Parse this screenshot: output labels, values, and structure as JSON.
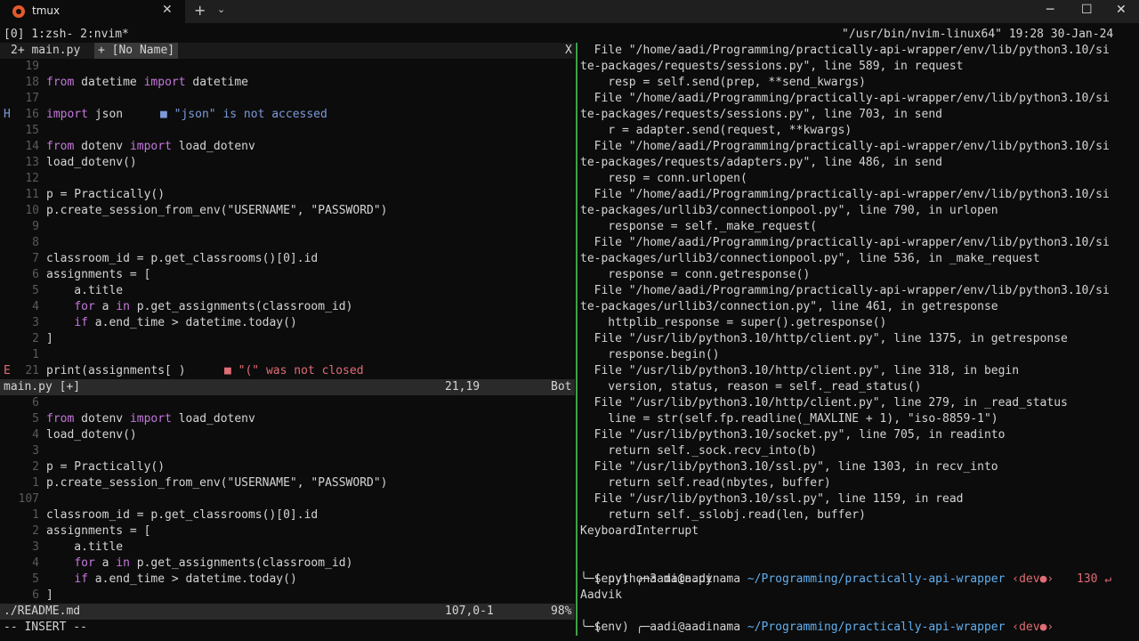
{
  "window": {
    "tab_title": "tmux",
    "close": "✕",
    "new_tab": "+",
    "dropdown": "⌄",
    "minimize": "─",
    "maximize": "☐",
    "close_window": "✕"
  },
  "tmux": {
    "status_left": "[0] 1:zsh- 2:nvim*",
    "status_right": "\"/usr/bin/nvim-linux64\" 19:28 30-Jan-24"
  },
  "nvim": {
    "tabline_left": "2+ main.py",
    "tabline_buf": "+ [No Name]",
    "tabline_close": "X",
    "top_lines": [
      {
        "num": "19",
        "text": ""
      },
      {
        "num": "18",
        "text": "from datetime import datetime"
      },
      {
        "num": "17",
        "text": ""
      },
      {
        "num": "16",
        "text": "import json",
        "sign": "H",
        "diag": "■ \"json\" is not accessed"
      },
      {
        "num": "15",
        "text": ""
      },
      {
        "num": "14",
        "text": "from dotenv import load_dotenv"
      },
      {
        "num": "13",
        "text": "load_dotenv()"
      },
      {
        "num": "12",
        "text": ""
      },
      {
        "num": "11",
        "text": "p = Practically()"
      },
      {
        "num": "10",
        "text": "p.create_session_from_env(\"USERNAME\", \"PASSWORD\")"
      },
      {
        "num": "9",
        "text": ""
      },
      {
        "num": "8",
        "text": ""
      },
      {
        "num": "7",
        "text": "classroom_id = p.get_classrooms()[0].id"
      },
      {
        "num": "6",
        "text": "assignments = ["
      },
      {
        "num": "5",
        "text": "    a.title"
      },
      {
        "num": "4",
        "text": "    for a in p.get_assignments(classroom_id)"
      },
      {
        "num": "3",
        "text": "    if a.end_time > datetime.today()"
      },
      {
        "num": "2",
        "text": "]"
      },
      {
        "num": "1",
        "text": ""
      },
      {
        "num": "21",
        "text": "print(assignments[ )",
        "sign": "E",
        "diag": "■ \"(\" was not closed"
      }
    ],
    "top_status_file": "main.py [+]",
    "top_status_pos": "21,19",
    "top_status_pct": "Bot",
    "bottom_lines": [
      {
        "num": "6",
        "text": ""
      },
      {
        "num": "5",
        "text": "from dotenv import load_dotenv"
      },
      {
        "num": "4",
        "text": "load_dotenv()"
      },
      {
        "num": "3",
        "text": ""
      },
      {
        "num": "2",
        "text": "p = Practically()"
      },
      {
        "num": "1",
        "text": "p.create_session_from_env(\"USERNAME\", \"PASSWORD\")"
      },
      {
        "num": "107",
        "text": ""
      },
      {
        "num": "1",
        "text": "classroom_id = p.get_classrooms()[0].id"
      },
      {
        "num": "2",
        "text": "assignments = ["
      },
      {
        "num": "3",
        "text": "    a.title"
      },
      {
        "num": "4",
        "text": "    for a in p.get_assignments(classroom_id)"
      },
      {
        "num": "5",
        "text": "    if a.end_time > datetime.today()"
      },
      {
        "num": "6",
        "text": "]"
      }
    ],
    "bottom_status_file": "./README.md",
    "bottom_status_pos": "107,0-1",
    "bottom_status_pct": "98%",
    "mode": "-- INSERT --"
  },
  "terminal": {
    "lines": [
      "  File \"/home/aadi/Programming/practically-api-wrapper/env/lib/python3.10/si",
      "te-packages/requests/sessions.py\", line 589, in request",
      "    resp = self.send(prep, **send_kwargs)",
      "  File \"/home/aadi/Programming/practically-api-wrapper/env/lib/python3.10/si",
      "te-packages/requests/sessions.py\", line 703, in send",
      "    r = adapter.send(request, **kwargs)",
      "  File \"/home/aadi/Programming/practically-api-wrapper/env/lib/python3.10/si",
      "te-packages/requests/adapters.py\", line 486, in send",
      "    resp = conn.urlopen(",
      "  File \"/home/aadi/Programming/practically-api-wrapper/env/lib/python3.10/si",
      "te-packages/urllib3/connectionpool.py\", line 790, in urlopen",
      "    response = self._make_request(",
      "  File \"/home/aadi/Programming/practically-api-wrapper/env/lib/python3.10/si",
      "te-packages/urllib3/connectionpool.py\", line 536, in _make_request",
      "    response = conn.getresponse()",
      "  File \"/home/aadi/Programming/practically-api-wrapper/env/lib/python3.10/si",
      "te-packages/urllib3/connection.py\", line 461, in getresponse",
      "    httplib_response = super().getresponse()",
      "  File \"/usr/lib/python3.10/http/client.py\", line 1375, in getresponse",
      "    response.begin()",
      "  File \"/usr/lib/python3.10/http/client.py\", line 318, in begin",
      "    version, status, reason = self._read_status()",
      "  File \"/usr/lib/python3.10/http/client.py\", line 279, in _read_status",
      "    line = str(self.fp.readline(_MAXLINE + 1), \"iso-8859-1\")",
      "  File \"/usr/lib/python3.10/socket.py\", line 705, in readinto",
      "    return self._sock.recv_into(b)",
      "  File \"/usr/lib/python3.10/ssl.py\", line 1303, in recv_into",
      "    return self.read(nbytes, buffer)",
      "  File \"/usr/lib/python3.10/ssl.py\", line 1159, in read",
      "    return self._sslobj.read(len, buffer)",
      "KeyboardInterrupt"
    ],
    "prompt1_env": "(env) ",
    "prompt1_user": "╭─aadi@aadinama",
    "prompt1_path": " ~/Programming/practically-api-wrapper",
    "prompt1_branch": " ‹dev●›",
    "prompt1_code": "130 ↵",
    "prompt1_cmd": "╰─$ python3 main.py",
    "output": "Aadvik",
    "prompt2_env": "(env) ",
    "prompt2_user": "╭─aadi@aadinama",
    "prompt2_path": " ~/Programming/practically-api-wrapper",
    "prompt2_branch": " ‹dev●›",
    "prompt2_cmd": "╰─$"
  }
}
